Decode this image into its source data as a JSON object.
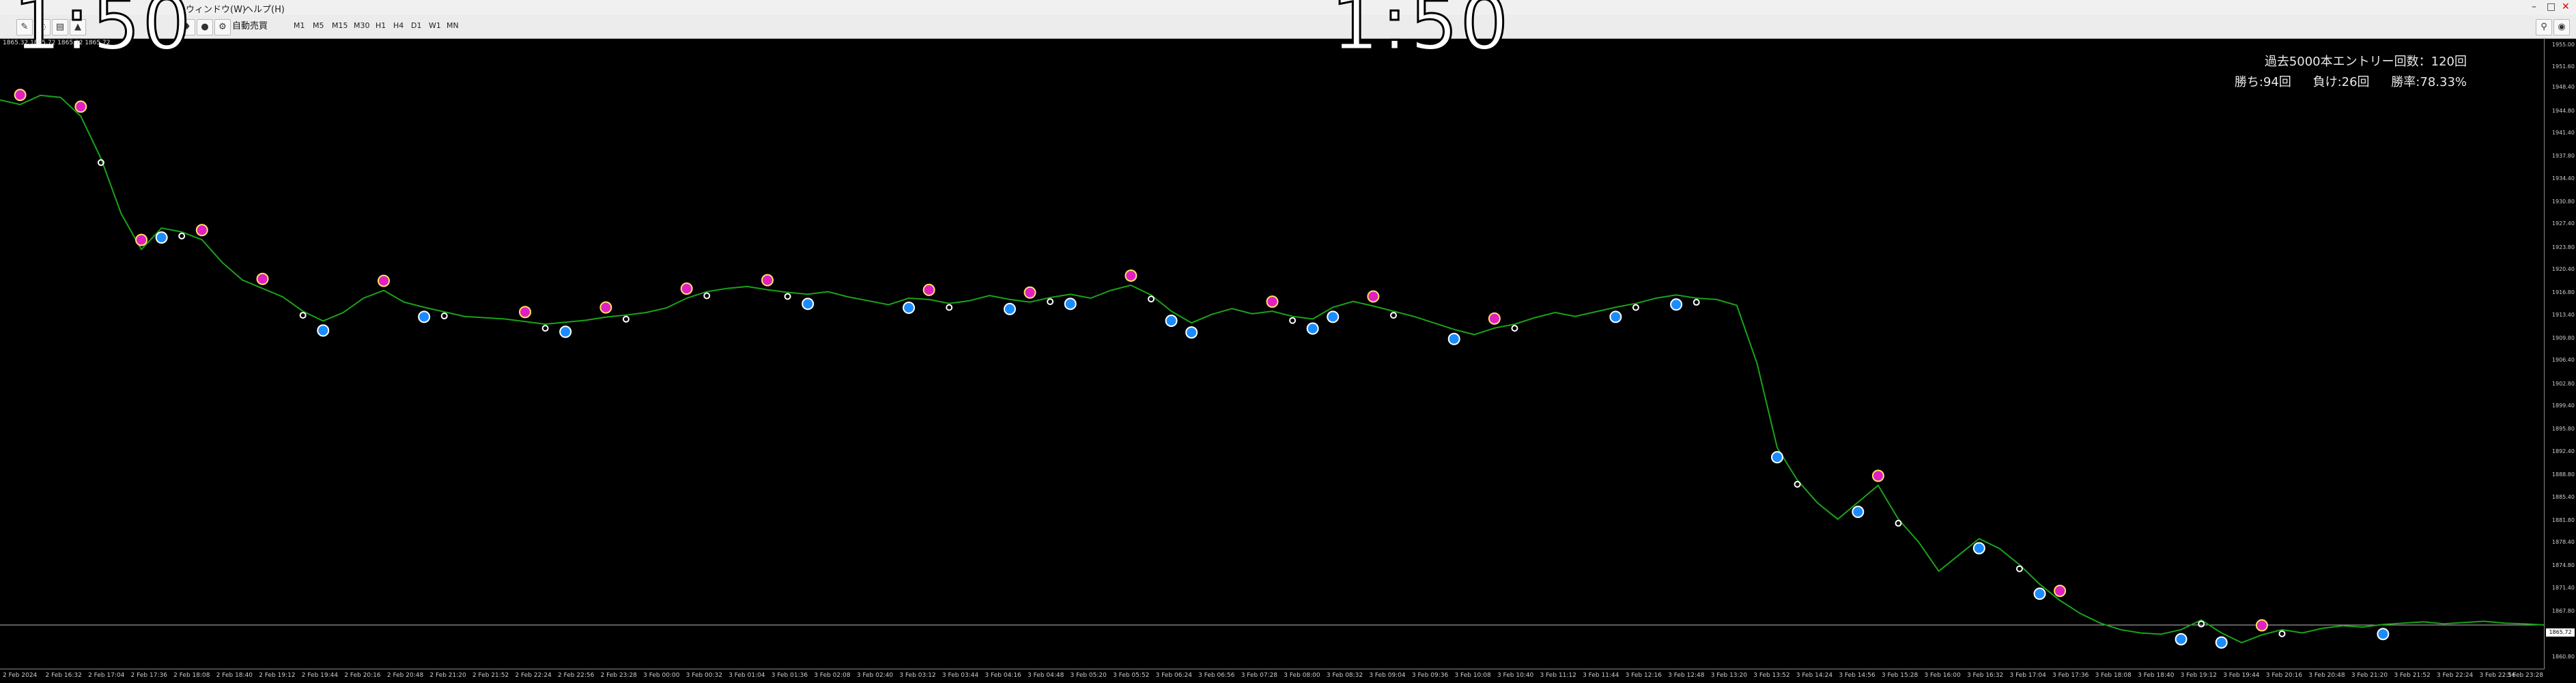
{
  "overlay": {
    "time_text": "1:50"
  },
  "menu": {
    "items": [
      "ウィンドウ(W)",
      "ヘルプ(H)"
    ]
  },
  "toolbar": {
    "autotrade_label": "自動売買",
    "timeframes": [
      "M1",
      "M5",
      "M15",
      "M30",
      "H1",
      "H4",
      "D1",
      "W1",
      "MN"
    ]
  },
  "chart_info": {
    "ohlc_text": "1865.32 1865.72 1865.32 1865.72"
  },
  "stats": {
    "line1": "過去5000本エントリー回数：120回",
    "line2_wins": "勝ち:94回",
    "line2_losses": "負け:26回",
    "line2_rate": "勝率:78.33%"
  },
  "current_price_label": "1865.72",
  "colors": {
    "price_line": "#19a319",
    "sell_marker": "#e020c0",
    "buy_marker": "#1a8cff",
    "exit_marker": "#ffffff",
    "background": "#000000"
  },
  "chart_data": {
    "type": "line",
    "series": [
      {
        "values": [
          1946.5,
          1945.8,
          1947.2,
          1946.9,
          1944.0,
          1937.5,
          1929.0,
          1923.5,
          1926.8,
          1926.2,
          1925.0,
          1921.5,
          1918.8,
          1917.5,
          1916.2,
          1914.0,
          1912.5,
          1913.8,
          1916.0,
          1917.2,
          1915.4,
          1914.6,
          1913.9,
          1913.2,
          1913.0,
          1912.8,
          1912.4,
          1912.0,
          1912.3,
          1912.6,
          1913.1,
          1913.4,
          1913.8,
          1914.5,
          1916.0,
          1917.0,
          1917.5,
          1917.8,
          1917.3,
          1916.9,
          1916.6,
          1917.0,
          1916.2,
          1915.6,
          1915.0,
          1916.0,
          1915.8,
          1915.2,
          1915.6,
          1916.4,
          1915.8,
          1915.4,
          1916.1,
          1916.6,
          1916.0,
          1917.2,
          1918.0,
          1916.5,
          1914.0,
          1912.2,
          1913.5,
          1914.4,
          1913.6,
          1914.0,
          1913.2,
          1912.8,
          1914.6,
          1915.5,
          1914.8,
          1914.0,
          1913.2,
          1912.2,
          1911.2,
          1910.4,
          1911.4,
          1912.0,
          1913.0,
          1913.8,
          1913.2,
          1913.9,
          1914.6,
          1915.2,
          1916.0,
          1916.5,
          1916.0,
          1915.8,
          1914.9,
          1906.0,
          1893.0,
          1888.0,
          1884.5,
          1882.0,
          1884.6,
          1887.2,
          1882.0,
          1878.5,
          1874.0,
          1876.5,
          1879.0,
          1877.5,
          1875.0,
          1872.0,
          1869.5,
          1867.5,
          1866.0,
          1865.0,
          1864.5,
          1864.3,
          1865.0,
          1866.5,
          1864.5,
          1863.0,
          1864.2,
          1865.0,
          1864.5,
          1865.2,
          1865.6,
          1865.4,
          1865.8,
          1866.0,
          1866.2,
          1865.9,
          1866.1,
          1866.3,
          1866.0,
          1865.9,
          1865.72
        ]
      }
    ],
    "x_ticks": [
      "2 Feb 2024",
      "2 Feb 16:32",
      "2 Feb 17:04",
      "2 Feb 17:36",
      "2 Feb 18:08",
      "2 Feb 18:40",
      "2 Feb 19:12",
      "2 Feb 19:44",
      "2 Feb 20:16",
      "2 Feb 20:48",
      "2 Feb 21:20",
      "2 Feb 21:52",
      "2 Feb 22:24",
      "2 Feb 22:56",
      "2 Feb 23:28",
      "3 Feb 00:00",
      "3 Feb 00:32",
      "3 Feb 01:04",
      "3 Feb 01:36",
      "3 Feb 02:08",
      "3 Feb 02:40",
      "3 Feb 03:12",
      "3 Feb 03:44",
      "3 Feb 04:16",
      "3 Feb 04:48",
      "3 Feb 05:20",
      "3 Feb 05:52",
      "3 Feb 06:24",
      "3 Feb 06:56",
      "3 Feb 07:28",
      "3 Feb 08:00",
      "3 Feb 08:32",
      "3 Feb 09:04",
      "3 Feb 09:36",
      "3 Feb 10:08",
      "3 Feb 10:40",
      "3 Feb 11:12",
      "3 Feb 11:44",
      "3 Feb 12:16",
      "3 Feb 12:48",
      "3 Feb 13:20",
      "3 Feb 13:52",
      "3 Feb 14:24",
      "3 Feb 14:56",
      "3 Feb 15:28",
      "3 Feb 16:00",
      "3 Feb 16:32",
      "3 Feb 17:04",
      "3 Feb 17:36",
      "3 Feb 18:08",
      "3 Feb 18:40",
      "3 Feb 19:12",
      "3 Feb 19:44",
      "3 Feb 20:16",
      "3 Feb 20:48",
      "3 Feb 21:20",
      "3 Feb 21:52",
      "3 Feb 22:24",
      "3 Feb 22:56",
      "3 Feb 23:28"
    ],
    "y_ticks": [
      "1955.00",
      "1951.60",
      "1948.40",
      "1944.80",
      "1941.40",
      "1937.80",
      "1934.40",
      "1930.80",
      "1927.40",
      "1923.80",
      "1920.40",
      "1916.80",
      "1913.40",
      "1909.80",
      "1906.40",
      "1902.80",
      "1899.40",
      "1895.80",
      "1892.40",
      "1888.80",
      "1885.40",
      "1881.80",
      "1878.40",
      "1874.80",
      "1871.40",
      "1867.80",
      "1864.40",
      "1860.80"
    ],
    "ylim": [
      1859.0,
      1956.0
    ],
    "markers": {
      "sell": [
        1,
        4,
        7,
        10,
        13,
        19,
        26,
        30,
        34,
        38,
        46,
        51,
        56,
        63,
        68,
        74,
        93,
        102,
        112
      ],
      "buy": [
        8,
        16,
        21,
        28,
        40,
        45,
        50,
        53,
        58,
        59,
        65,
        66,
        72,
        80,
        83,
        88,
        92,
        98,
        101,
        108,
        110,
        118
      ],
      "exit": [
        5,
        9,
        15,
        22,
        27,
        31,
        35,
        39,
        47,
        52,
        57,
        64,
        69,
        75,
        81,
        84,
        89,
        94,
        100,
        109,
        113
      ]
    }
  }
}
